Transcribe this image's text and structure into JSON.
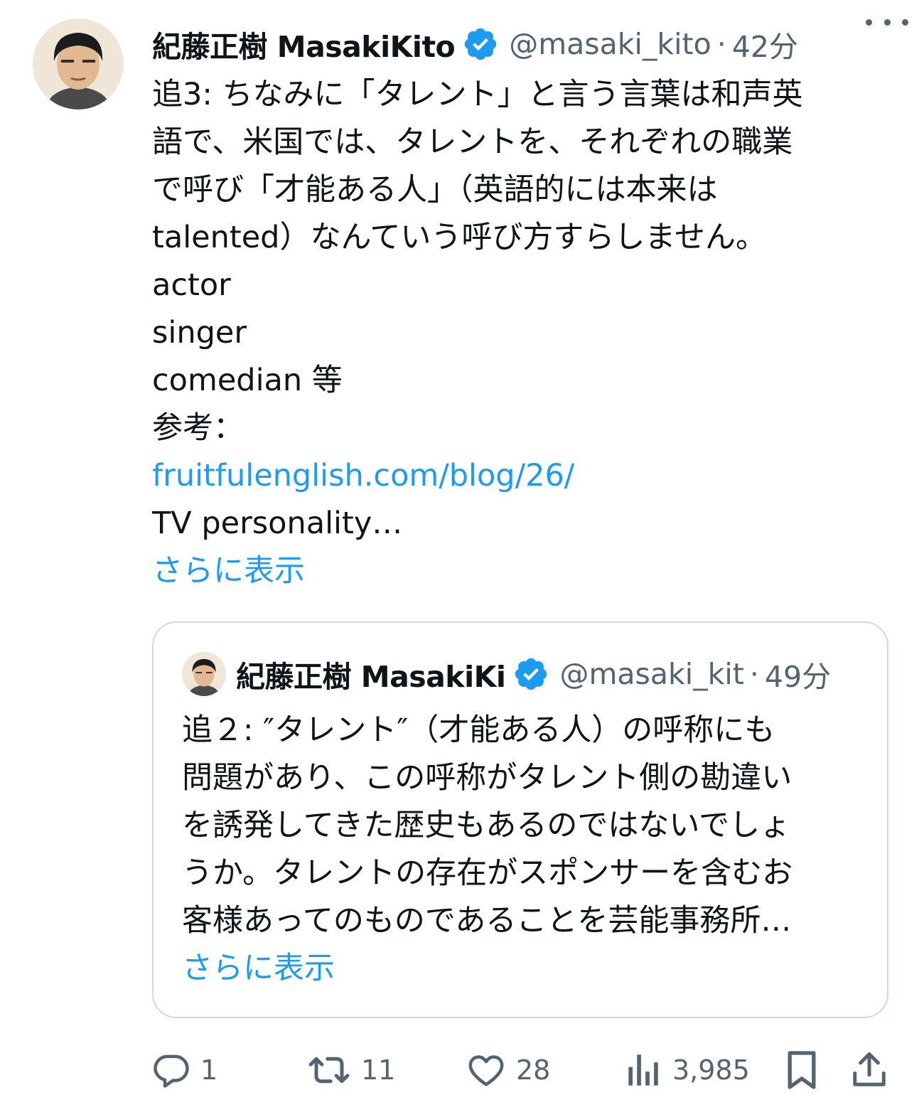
{
  "tweet": {
    "author_name": "紀藤正樹 MasakiKito",
    "handle": "@masaki_kito",
    "separator": "·",
    "time": "42分",
    "verified_icon": "verified-badge-icon",
    "more_icon": "more-dots-icon",
    "lines": [
      "追3: ちなみに「タレント」と言う言葉は和声英",
      "語で、米国では、タレントを、それぞれの職業",
      "で呼び「才能ある人」（英語的には本来は",
      "talented）なんていう呼び方すらしません。",
      "actor",
      "singer",
      "comedian 等",
      "参考："
    ],
    "link": "fruitfulenglish.com/blog/26/",
    "after_link": "TV personality…",
    "show_more": "さらに表示"
  },
  "quote": {
    "author_name": "紀藤正樹 MasakiKi",
    "handle": "@masaki_kit",
    "separator": "·",
    "time": "49分",
    "lines": [
      "追２: ″タレント″（才能ある人）の呼称にも",
      "問題があり、この呼称がタレント側の勘違い",
      "を誘発してきた歴史もあるのではないでしょ",
      "うか。タレントの存在がスポンサーを含むお",
      "客様あってのものであることを芸能事務所…"
    ],
    "show_more": "さらに表示"
  },
  "actions": {
    "reply_count": "1",
    "repost_count": "11",
    "like_count": "28",
    "views_count": "3,985",
    "icons": [
      "reply-icon",
      "repost-icon",
      "like-icon",
      "views-icon",
      "bookmark-icon",
      "share-icon"
    ]
  },
  "colors": {
    "link": "#1d9bf0",
    "secondary_text": "#536471",
    "border": "#cfd9de",
    "verified": "#1d9bf0"
  }
}
